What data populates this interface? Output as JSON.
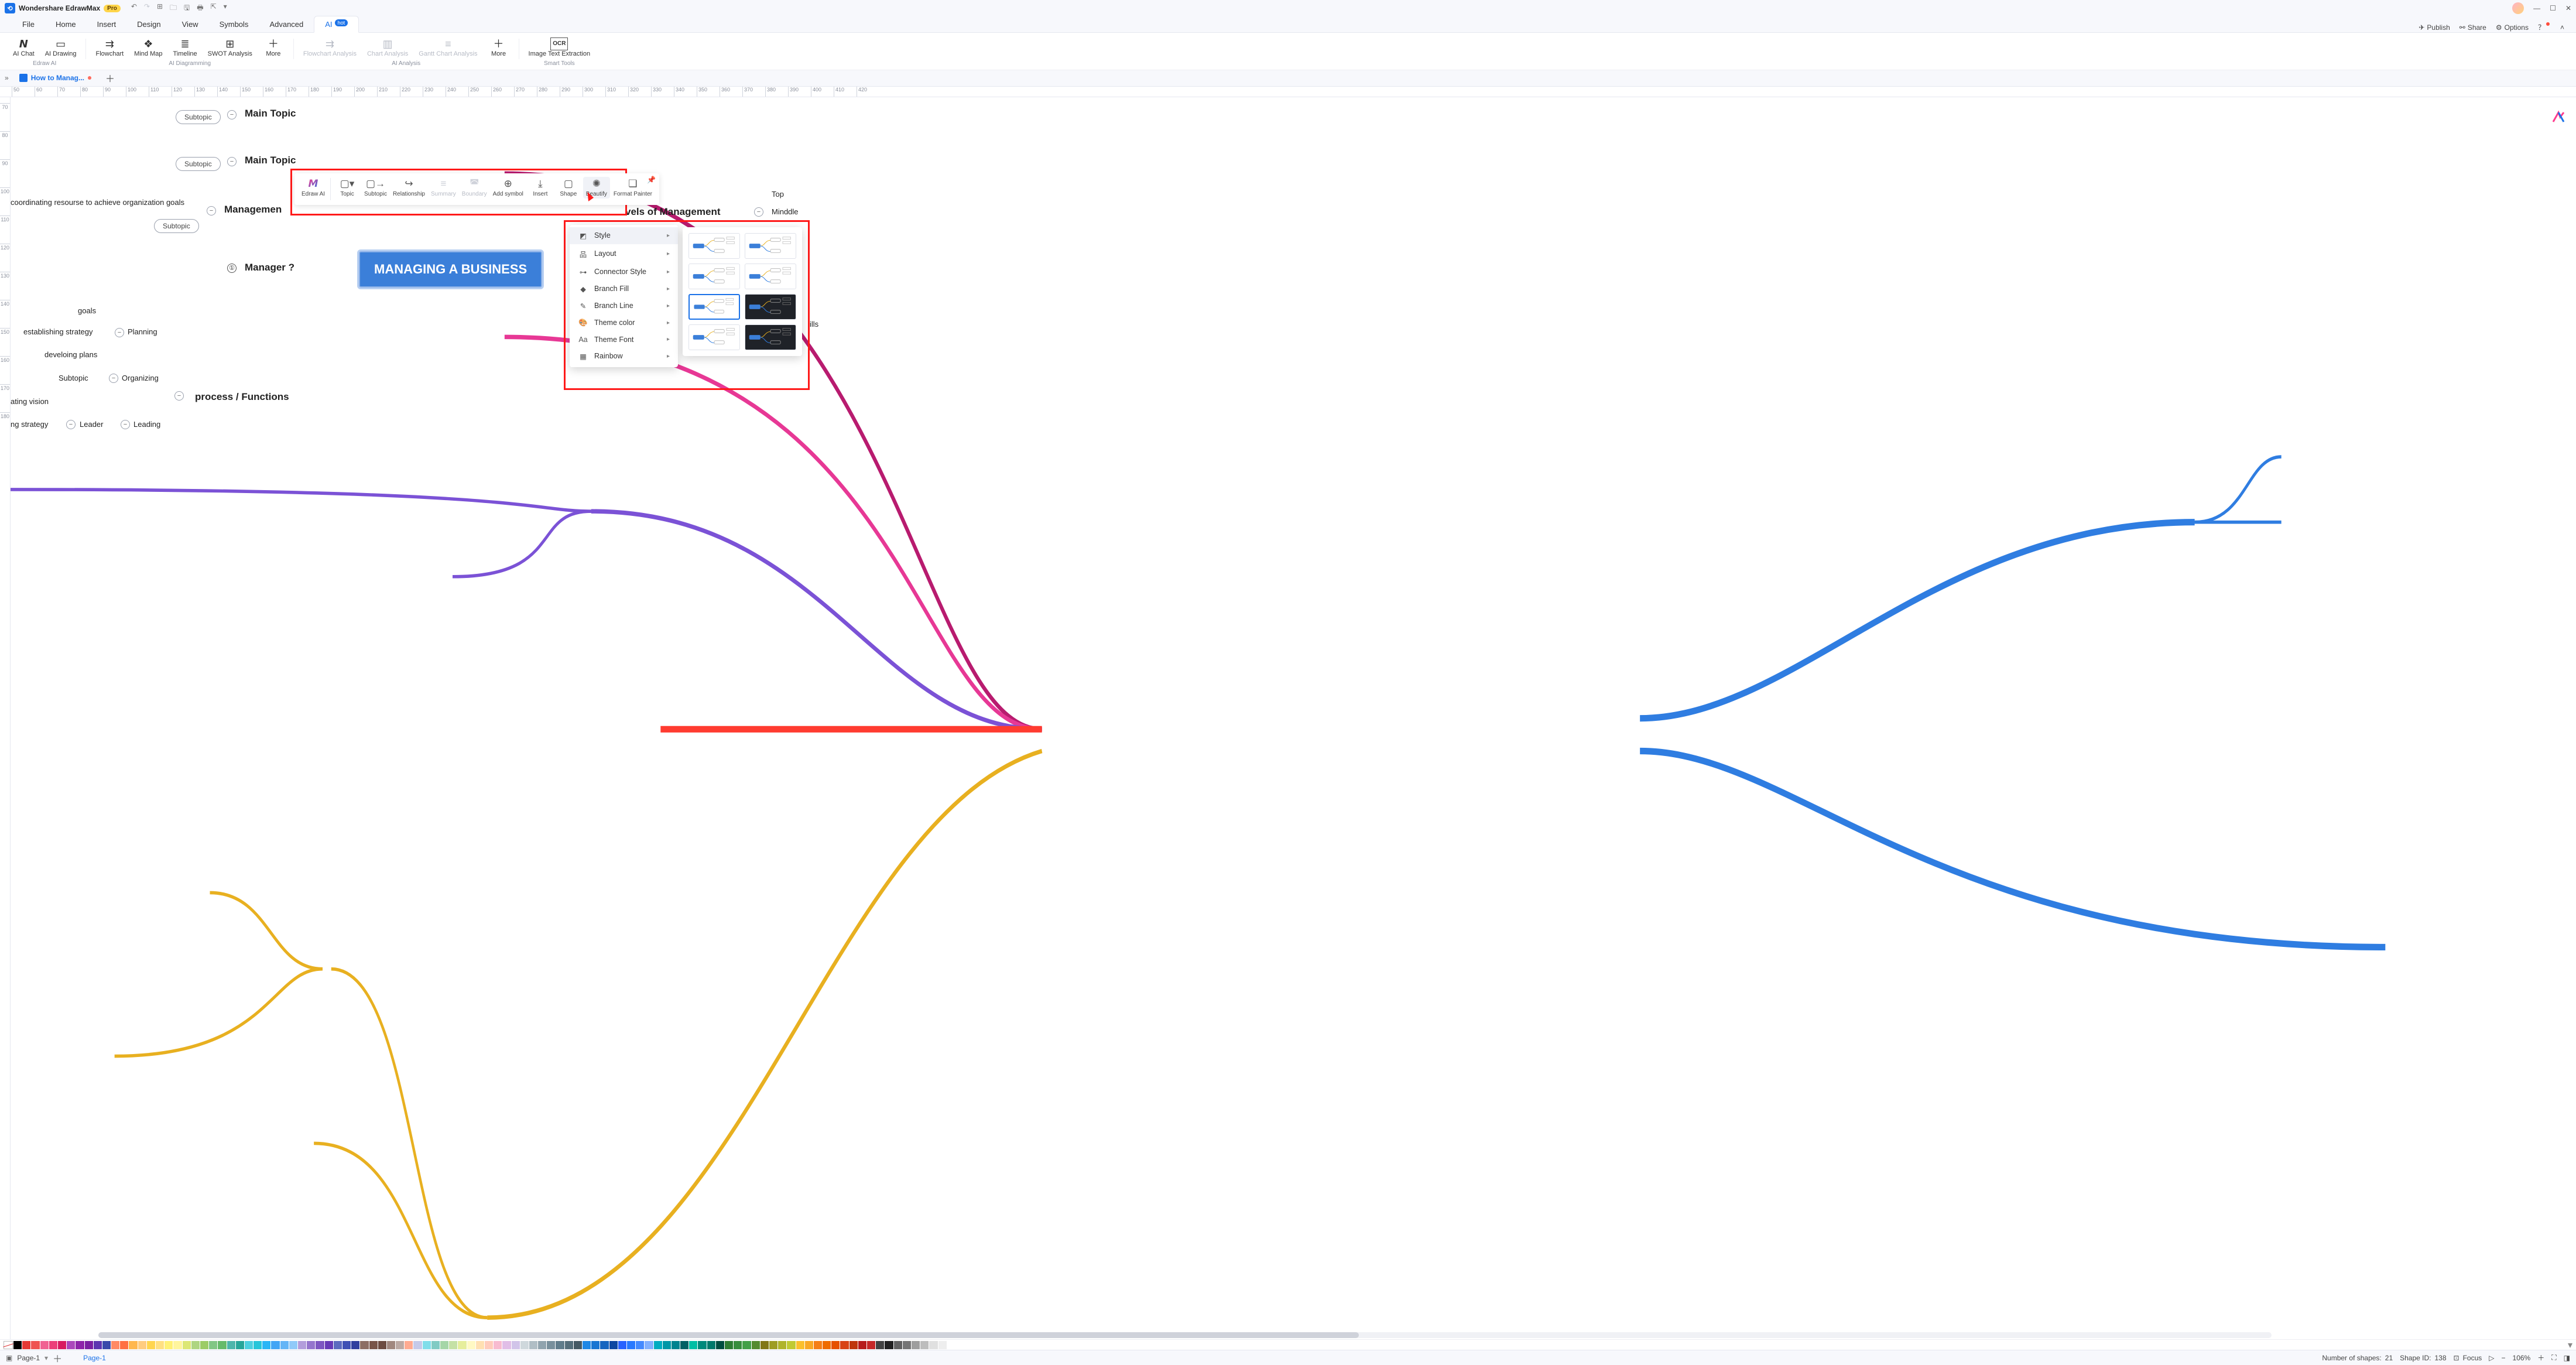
{
  "titlebar": {
    "app_name": "Wondershare EdrawMax",
    "pro_badge": "Pro"
  },
  "menu": {
    "tabs": [
      "File",
      "Home",
      "Insert",
      "Design",
      "View",
      "Symbols",
      "Advanced",
      "AI"
    ],
    "active_index": 7,
    "hot_badge": "hot",
    "right": {
      "publish": "Publish",
      "share": "Share",
      "options": "Options"
    }
  },
  "ribbon": {
    "groups": [
      {
        "label": "Edraw AI",
        "items": [
          {
            "id": "ai-chat",
            "label": "AI Chat",
            "icon": "✦"
          },
          {
            "id": "ai-drawing",
            "label": "AI Drawing",
            "icon": "▭"
          }
        ]
      },
      {
        "label": "AI Diagramming",
        "items": [
          {
            "id": "flowchart",
            "label": "Flowchart",
            "icon": "⇄"
          },
          {
            "id": "mindmap",
            "label": "Mind Map",
            "icon": "❖"
          },
          {
            "id": "timeline",
            "label": "Timeline",
            "icon": "≣"
          },
          {
            "id": "swot",
            "label": "SWOT Analysis",
            "icon": "⊞"
          },
          {
            "id": "more1",
            "label": "More",
            "icon": "＋",
            "drop": true
          }
        ]
      },
      {
        "label": "AI Analysis",
        "items": [
          {
            "id": "flow-an",
            "label": "Flowchart Analysis",
            "icon": "⇄",
            "disabled": true,
            "drop": true
          },
          {
            "id": "chart-an",
            "label": "Chart Analysis",
            "icon": "▥",
            "disabled": true,
            "drop": true
          },
          {
            "id": "gantt-an",
            "label": "Gantt Chart Analysis",
            "icon": "≡",
            "disabled": true,
            "drop": true
          },
          {
            "id": "more2",
            "label": "More",
            "icon": "＋",
            "drop": true
          }
        ]
      },
      {
        "label": "Smart Tools",
        "items": [
          {
            "id": "ocr",
            "label": "Image Text Extraction",
            "icon": "OCR"
          }
        ]
      }
    ]
  },
  "doc_tab": {
    "title": "How to Manag...",
    "modified": true
  },
  "ruler_h": [
    50,
    60,
    70,
    80,
    90,
    100,
    110,
    120,
    130,
    140,
    150,
    160,
    170,
    180,
    190,
    200,
    210,
    220,
    230,
    240,
    250,
    260,
    270,
    280,
    290,
    300,
    310,
    320,
    330,
    340,
    350,
    360,
    370,
    380,
    390,
    400,
    410,
    420
  ],
  "ruler_v": [
    70,
    80,
    90,
    100,
    110,
    120,
    130,
    140,
    150,
    160,
    170,
    180
  ],
  "central_topic": "MANAGING A BUSINESS",
  "nodes": {
    "main_topic_a": "Main Topic",
    "main_topic_b": "Main Topic",
    "subtopic": "Subtopic",
    "coord_res": "coordinating resourse to achieve organization goals",
    "management": "Managemen",
    "manager_num": "①",
    "manager_q": "Manager ?",
    "goals": "goals",
    "est_strategy": "establishing strategy",
    "dev_plans": "develoing plans",
    "planning": "Planning",
    "organizing": "Organizing",
    "proc_func": "process / Functions",
    "ating_vision": "ating vision",
    "ng_strategy": "ng strategy",
    "leader": "Leader",
    "leading": "Leading",
    "levels_mgmt": "vels of Management",
    "top": "Top",
    "middle": "Minddle",
    "ills": "ills"
  },
  "float_toolbar": {
    "items": [
      {
        "id": "edraw-ai",
        "label": "Edraw AI",
        "icon": "AI"
      },
      {
        "id": "topic",
        "label": "Topic",
        "icon": "□",
        "drop": true
      },
      {
        "id": "subtopic",
        "label": "Subtopic",
        "icon": "□→"
      },
      {
        "id": "relationship",
        "label": "Relationship",
        "icon": "↪"
      },
      {
        "id": "summary",
        "label": "Summary",
        "icon": "≡",
        "disabled": true
      },
      {
        "id": "boundary",
        "label": "Boundary",
        "icon": "◚",
        "disabled": true
      },
      {
        "id": "addsymbol",
        "label": "Add symbol",
        "icon": "⊕"
      },
      {
        "id": "insert",
        "label": "Insert",
        "icon": "⤓"
      },
      {
        "id": "shape",
        "label": "Shape",
        "icon": "▢"
      },
      {
        "id": "beautify",
        "label": "Beautify",
        "icon": "✺",
        "hl": true
      },
      {
        "id": "format-painter",
        "label": "Format Painter",
        "icon": "❏",
        "drop": true
      }
    ]
  },
  "beautify_menu": {
    "items": [
      {
        "id": "style",
        "label": "Style",
        "icon": "◩",
        "selected": true
      },
      {
        "id": "layout",
        "label": "Layout",
        "icon": "品"
      },
      {
        "id": "connector",
        "label": "Connector Style",
        "icon": "⊶"
      },
      {
        "id": "branch-fill",
        "label": "Branch Fill",
        "icon": "◆"
      },
      {
        "id": "branch-line",
        "label": "Branch Line",
        "icon": "✎"
      },
      {
        "id": "theme-color",
        "label": "Theme color",
        "icon": "🎨"
      },
      {
        "id": "theme-font",
        "label": "Theme Font",
        "icon": "Aa"
      },
      {
        "id": "rainbow",
        "label": "Rainbow",
        "icon": "▦"
      }
    ]
  },
  "style_thumbs": [
    {
      "id": 0,
      "dark": false
    },
    {
      "id": 1,
      "dark": false
    },
    {
      "id": 2,
      "dark": false
    },
    {
      "id": 3,
      "dark": false
    },
    {
      "id": 4,
      "dark": false,
      "selected": true
    },
    {
      "id": 5,
      "dark": true
    },
    {
      "id": 6,
      "dark": false
    },
    {
      "id": 7,
      "dark": true
    }
  ],
  "colors": [
    "#000000",
    "#e53935",
    "#ef5350",
    "#f06292",
    "#ec407a",
    "#d81b60",
    "#ab47bc",
    "#8e24aa",
    "#7b1fa2",
    "#5e35b1",
    "#3949ab",
    "#ff8a65",
    "#ff7043",
    "#ffb74d",
    "#ffcc80",
    "#ffd54f",
    "#ffe082",
    "#fff176",
    "#fff59d",
    "#dce775",
    "#aed581",
    "#9ccc65",
    "#81c784",
    "#66bb6a",
    "#4db6ac",
    "#26a69a",
    "#4dd0e1",
    "#26c6da",
    "#29b6f6",
    "#42a5f5",
    "#64b5f6",
    "#90caf9",
    "#b39ddb",
    "#9575cd",
    "#7e57c2",
    "#673ab7",
    "#5c6bc0",
    "#3f51b5",
    "#303f9f",
    "#8d6e63",
    "#795548",
    "#6d4c41",
    "#a1887f",
    "#bcaaa4",
    "#ffab91",
    "#c5cae9",
    "#80deea",
    "#80cbc4",
    "#a5d6a7",
    "#c5e1a5",
    "#e6ee9c",
    "#fff9c4",
    "#ffe0b2",
    "#ffccbc",
    "#f8bbd0",
    "#e1bee7",
    "#d1c4e9",
    "#cfd8dc",
    "#b0bec5",
    "#90a4ae",
    "#78909c",
    "#607d8b",
    "#546e7a",
    "#455a64",
    "#1e88e5",
    "#1976d2",
    "#1565c0",
    "#0d47a1",
    "#2962ff",
    "#2979ff",
    "#448aff",
    "#82b1ff",
    "#00acc1",
    "#0097a7",
    "#00838f",
    "#006064",
    "#00bfa5",
    "#00897b",
    "#00796b",
    "#004d40",
    "#2e7d32",
    "#388e3c",
    "#43a047",
    "#558b2f",
    "#827717",
    "#9e9d24",
    "#afb42b",
    "#c0ca33",
    "#fbc02d",
    "#f9a825",
    "#f57f17",
    "#ef6c00",
    "#e65100",
    "#d84315",
    "#bf360c",
    "#b71c1c",
    "#c62828",
    "#424242",
    "#212121",
    "#616161",
    "#757575",
    "#9e9e9e",
    "#bdbdbd",
    "#e0e0e0",
    "#eeeeee",
    "#ffffff"
  ],
  "status": {
    "page_label": "Page-1",
    "page_link": "Page-1",
    "shapes_label": "Number of shapes:",
    "shapes_count": "21",
    "shape_id_label": "Shape ID:",
    "shape_id": "138",
    "focus": "Focus",
    "zoom": "106%"
  }
}
